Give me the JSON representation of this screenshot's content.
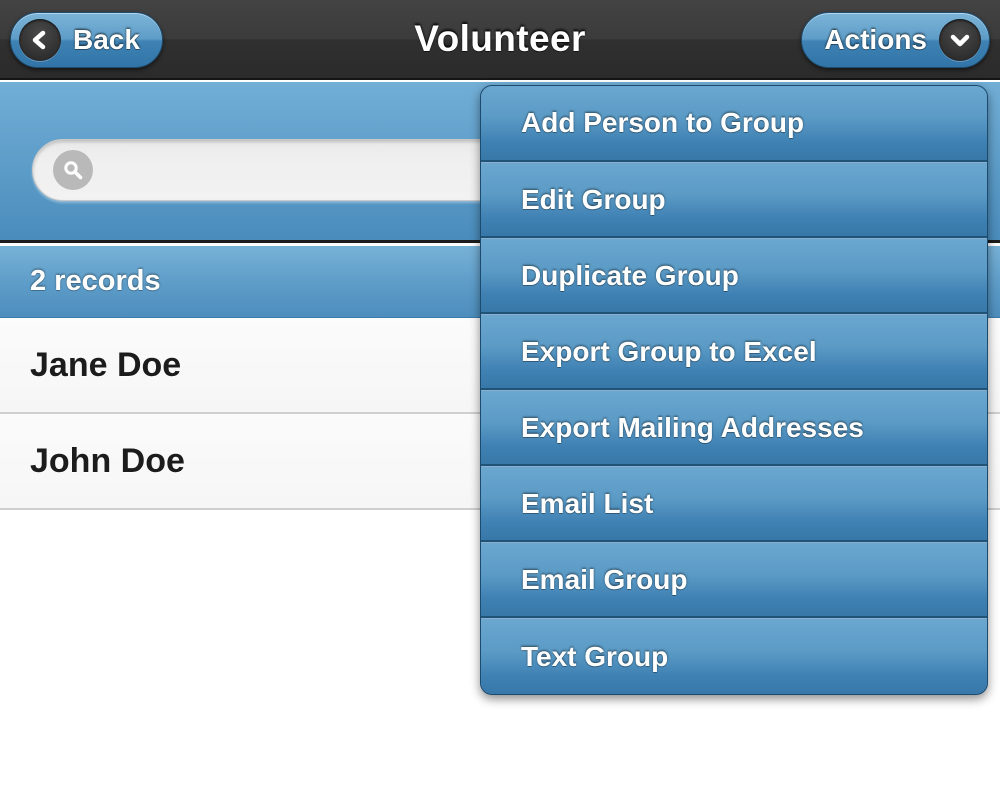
{
  "navbar": {
    "title": "Volunteer",
    "back_label": "Back",
    "back_icon": "chevron-left-icon",
    "actions_label": "Actions",
    "actions_icon": "chevron-down-icon",
    "background_color": "#333333"
  },
  "search": {
    "value": "",
    "placeholder": "",
    "icon": "search-icon",
    "background_color": "#5c9cc8"
  },
  "list": {
    "records_count_label": "2 records",
    "rows": [
      {
        "name": "Jane Doe"
      },
      {
        "name": "John Doe"
      }
    ]
  },
  "actions_menu": {
    "visible": true,
    "accent_color": "#3d80b2",
    "items": [
      {
        "label": "Add Person to Group"
      },
      {
        "label": "Edit Group"
      },
      {
        "label": "Duplicate Group"
      },
      {
        "label": "Export Group to Excel"
      },
      {
        "label": "Export Mailing Addresses"
      },
      {
        "label": "Email List"
      },
      {
        "label": "Email Group"
      },
      {
        "label": "Text Group"
      }
    ]
  }
}
